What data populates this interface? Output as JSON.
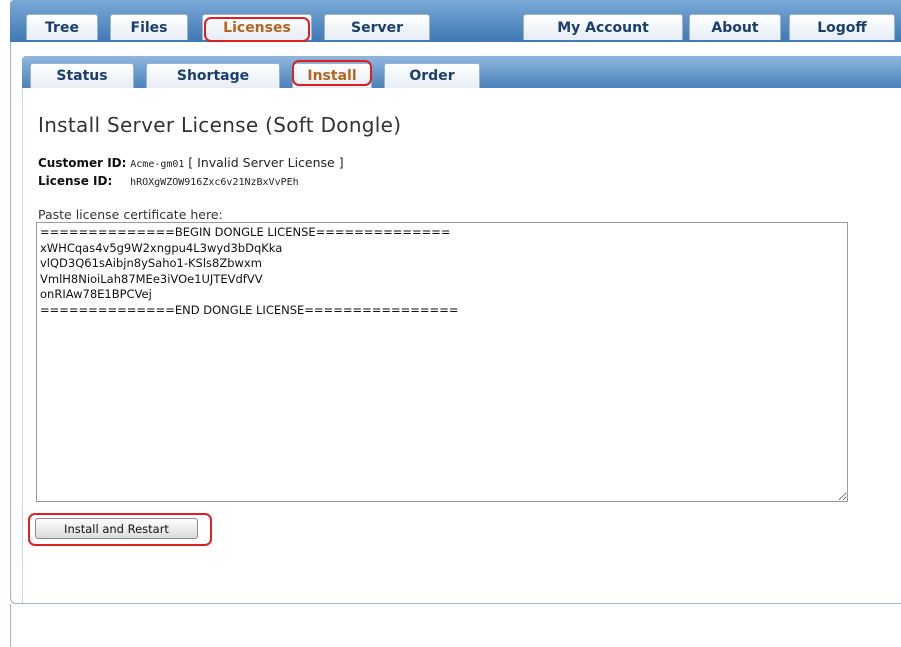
{
  "top_nav": {
    "tabs": [
      {
        "label": "Tree"
      },
      {
        "label": "Files"
      },
      {
        "label": "Licenses",
        "active": true
      },
      {
        "label": "Server"
      },
      {
        "label": "My Account"
      },
      {
        "label": "About"
      },
      {
        "label": "Logoff"
      }
    ]
  },
  "sub_nav": {
    "tabs": [
      {
        "label": "Status"
      },
      {
        "label": "Shortage"
      },
      {
        "label": "Install",
        "active": true
      },
      {
        "label": "Order"
      }
    ]
  },
  "page": {
    "title": "Install Server License (Soft Dongle)",
    "customer_id_label": "Customer ID:",
    "customer_id_value": "Acme-gm01",
    "customer_status": "[ Invalid Server License ]",
    "license_id_label": "License ID:",
    "license_id_value": "hROXgWZOW916Zxc6v21NzBxVvPEh",
    "paste_label": "Paste license certificate here:",
    "certificate": "==============BEGIN DONGLE LICENSE==============\nxWHCqas4v5g9W2xngpu4L3wyd3bDqKka\nvlQD3Q61sAibjn8ySaho1-KSls8Zbwxm\nVmlH8NioiLah87MEe3iVOe1UJTEVdfVV\nonRIAw78E1BPCVej\n==============END DONGLE LICENSE================",
    "install_button": "Install and Restart"
  },
  "colors": {
    "nav_bar": "#3f78b3",
    "tab_text": "#1a3f6e",
    "active_tab_text": "#b5651d",
    "highlight": "#e02020"
  }
}
